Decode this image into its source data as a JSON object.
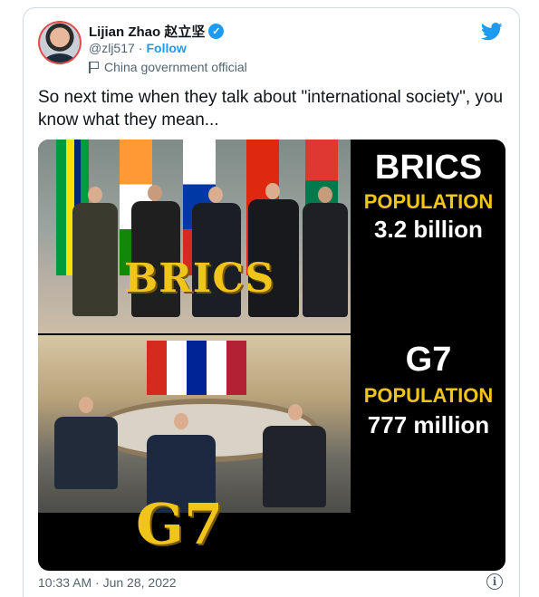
{
  "author": {
    "name": "Lijian Zhao 赵立坚",
    "handle": "@zlj517",
    "separator": "·",
    "follow_label": "Follow",
    "label": "China government official",
    "avatar_icon": "profile-photo"
  },
  "tweet": {
    "text": "So next time when they talk about \"international society\", you know what they mean...",
    "timestamp": "10:33 AM · Jun 28, 2022"
  },
  "media": {
    "brics_logo": "BRICS",
    "g7_logo": "G7",
    "brics_title": "BRICS",
    "brics_pop_label": "POPULATION",
    "brics_pop_value": "3.2 billion",
    "g7_title": "G7",
    "g7_pop_label": "POPULATION",
    "g7_pop_value": "777 million"
  },
  "icons": {
    "verified": "verified-badge-icon",
    "bird": "twitter-bird-icon",
    "info": "info-icon",
    "flag": "government-label-icon"
  },
  "colors": {
    "accent": "#1d9bf0",
    "text": "#0f1419",
    "muted": "#536471",
    "gold": "#f0c419"
  }
}
